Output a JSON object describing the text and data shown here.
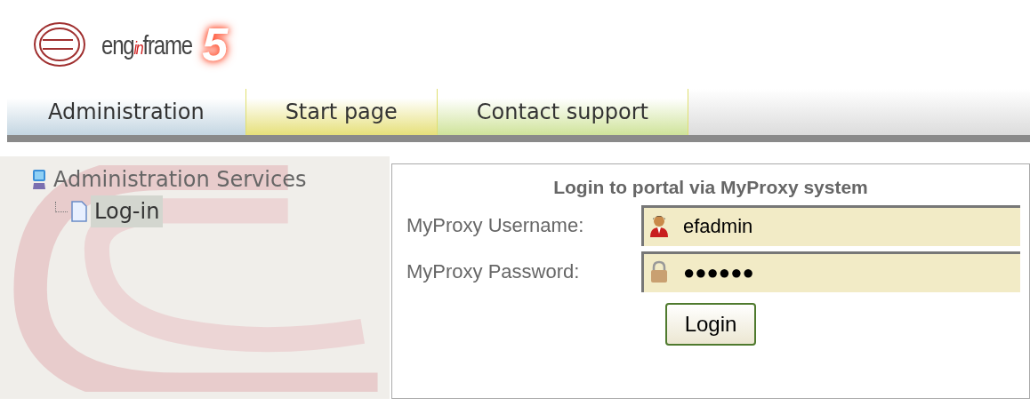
{
  "logo": {
    "parts": [
      {
        "text": "eng",
        "accent": false
      },
      {
        "text": "in",
        "accent": true
      },
      {
        "text": "frame",
        "accent": false
      }
    ],
    "version": "5"
  },
  "tabs": [
    {
      "label": "Administration",
      "color": "#c4d6e2"
    },
    {
      "label": "Start page",
      "color": "#e6e07a"
    },
    {
      "label": "Contact support",
      "color": "#cfe39a"
    }
  ],
  "tree": [
    {
      "label": "Administration Services",
      "selected": false,
      "children": [
        {
          "label": "Log-in",
          "selected": true
        }
      ]
    }
  ],
  "login": {
    "title": "Login to portal via MyProxy system",
    "fields": [
      {
        "label": "MyProxy Username:",
        "value": "efadmin",
        "kind": "user"
      },
      {
        "label": "MyProxy Password:",
        "value": "●●●●●●",
        "kind": "password"
      }
    ],
    "button": "Login"
  }
}
